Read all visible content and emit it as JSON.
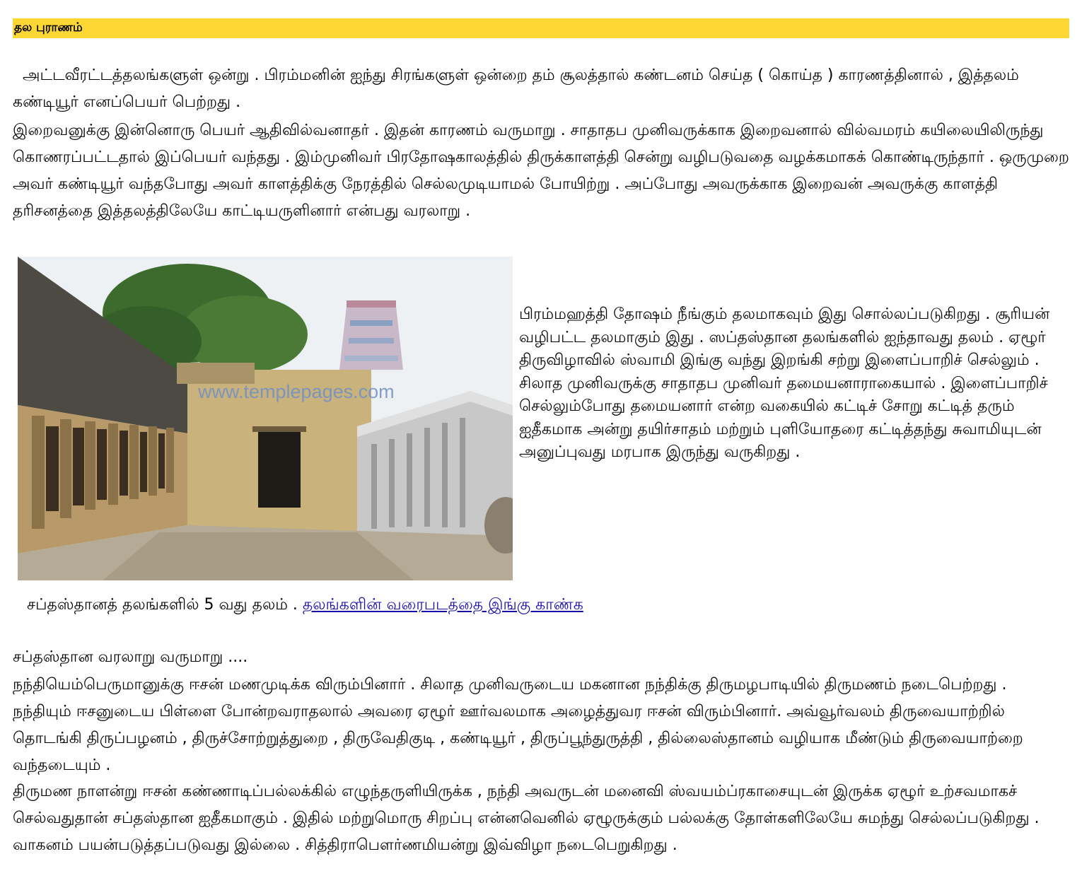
{
  "header": {
    "title": "தல புராணம்"
  },
  "paragraphs": {
    "p1": "அட்டவீரட்டத்தலங்களுள் ஒன்று . பிரம்மனின் ஐந்து சிரங்களுள் ஒன்றை தம் சூலத்தால் கண்டனம் செய்த ( கொய்த ) காரணத்தினால் , இத்தலம் கண்டியூர் எனப்பெயர் பெற்றது .",
    "p2": "இறைவனுக்கு இன்னொரு பெயர் ஆதிவில்வனாதர் . இதன் காரணம் வருமாறு . சாதாதப முனிவருக்காக இறைவனால் வில்வமரம் கயிலையிலிருந்து கொணரப்பட்டதால் இப்பெயர் வந்தது . இம்முனிவர் பிரதோஷகாலத்தில் திருக்காளத்தி சென்று வழிபடுவதை வழக்கமாகக் கொண்டிருந்தார் . ஒருமுறை அவர் கண்டியூர் வந்தபோது அவர் காளத்திக்கு நேரத்தில் செல்லமுடியாமல் போயிற்று . அப்போது அவருக்காக இறைவன் அவருக்கு காளத்தி தரிசனத்தை இத்தலத்திலேயே காட்டியருளினார் என்பது வரலாறு .",
    "side": "பிரம்மஹத்தி தோஷம் நீங்கும் தலமாகவும் இது சொல்லப்படுகிறது . சூரியன் வழிபட்ட தலமாகும் இது . ஸப்தஸ்தான தலங்களில் ஐந்தாவது தலம் . ஏழூர் திருவிழாவில் ஸ்வாமி இங்கு வந்து இறங்கி சற்று இளைப்பாறிச் செல்லும் . சிலாத முனிவருக்கு சாதாதப முனிவர் தமையனாராகையால் . இளைப்பாறிச் செல்லும்போது தமையனார் என்ற வகையில் கட்டிச் சோறு கட்டித் தரும் ஐதீகமாக அன்று தயிர்சாதம் மற்றும் புளியோதரை கட்டித்தந்து சுவாமியுடன் அனுப்புவது மரபாக இருந்து வருகிறது .",
    "caption_text": "சப்தஸ்தானத் தலங்களில் 5 வது தலம் . ",
    "caption_link": "தலங்களின் வரைபடத்தை இங்கு காண்க",
    "p3": "சப்தஸ்தான வரலாறு வருமாறு ....",
    "p4": "நந்தியெம்பெருமானுக்கு ஈசன் மணமுடிக்க விரும்பினார் . சிலாத முனிவருடைய மகனான நந்திக்கு திருமழபாடியில் திருமணம் நடைபெற்றது . நந்தியும் ஈசனுடைய பிள்ளை போன்றவராதலால் அவரை ஏழூர் ஊர்வலமாக அழைத்துவர ஈசன் விரும்பினார். அவ்வூர்வலம் திருவையாற்றில் தொடங்கி திருப்பழனம் , திருச்சோற்றுத்துறை , திருவேதிகுடி , கண்டியூர் , திருப்பூந்துருத்தி , தில்லைஸ்தானம் வழியாக மீண்டும் திருவையாற்றை வந்தடையும் .",
    "p5": "திருமண நாளன்று ஈசன் கண்ணாடிப்பல்லக்கில் எழுந்தருளியிருக்க , நந்தி அவருடன் மனைவி ஸ்வயம்ப்ரகாசையுடன் இருக்க ஏழூர் உற்சவமாகச் செல்வதுதான் சப்தஸ்தான ஐதீகமாகும் . இதில் மற்றுமொரு சிறப்பு என்னவெனில் ஏழூருக்கும் பல்லக்கு தோள்களிலேயே சுமந்து செல்லப்படுகிறது . வாகனம் பயன்படுத்தப்படுவது இல்லை . சித்திராபௌர்ணமியன்று இவ்விழா நடைபெறுகிறது ."
  },
  "photo": {
    "watermark": "www.templepages.com"
  },
  "colors": {
    "header_bg": "#fdd835",
    "link": "#1a0dab"
  }
}
